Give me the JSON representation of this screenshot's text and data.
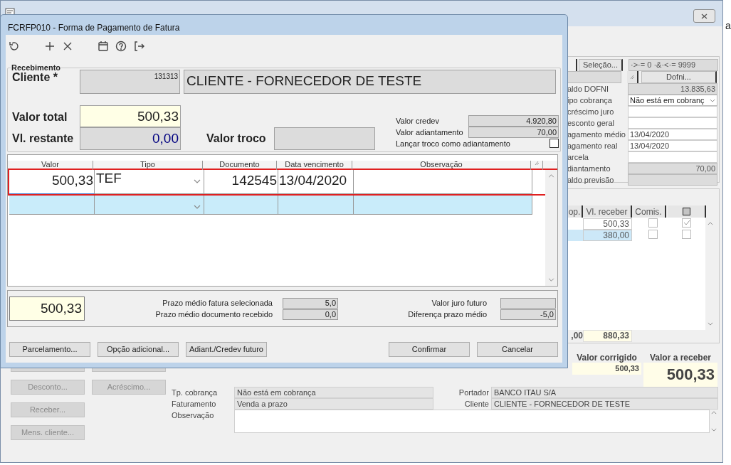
{
  "background_window": {
    "right_panel": {
      "selection_button": "Seleção...",
      "filter": "·>·= 0 ·&·<·= 9999",
      "dofni_button": "Dofni...",
      "fields": [
        {
          "label": "aldo DOFNI",
          "value": "13.835,63",
          "kind": "readonly"
        },
        {
          "label": "ipo cobrança",
          "value": "Não está em cobranç",
          "kind": "dropdown"
        },
        {
          "label": "créscimo juro",
          "kind": "input"
        },
        {
          "label": "esconto geral",
          "kind": "input"
        },
        {
          "label": "agamento médio",
          "value": "13/04/2020",
          "kind": "input"
        },
        {
          "label": "agamento real",
          "value": "13/04/2020",
          "kind": "input"
        },
        {
          "label": "arcela",
          "kind": "input"
        },
        {
          "label": "diantamento",
          "value": "70,00",
          "kind": "readonly"
        },
        {
          "label": "aldo previsão",
          "kind": "readonly"
        }
      ]
    },
    "installments": {
      "columns": [
        "op.",
        "Vl. receber",
        "Comis."
      ],
      "rows": [
        {
          "value": "500,33",
          "comis": false,
          "checked": true,
          "selected": false
        },
        {
          "value": "380,00",
          "comis": false,
          "checked": false,
          "selected": true
        }
      ],
      "totals": [
        ",00",
        "880,33"
      ]
    },
    "summary": {
      "columns": [
        "Valor corrigido",
        "Valor a receber"
      ],
      "values": [
        "500,33",
        "500,33"
      ]
    },
    "buttons_column_1": [
      {
        "label": "Desconto...",
        "disabled": true
      },
      {
        "label": "Receber...",
        "disabled": true
      },
      {
        "label": "Mens. cliente...",
        "disabled": true
      }
    ],
    "buttons_column_2": [
      {
        "label": "Acréscimo...",
        "disabled": true
      }
    ],
    "details_left": [
      {
        "label": "Tp. cobrança",
        "value": "Não está em cobrança"
      },
      {
        "label": "Faturamento",
        "value": "Venda a prazo"
      }
    ],
    "details_right": [
      {
        "label": "Portador",
        "value": "BANCO ITAU S/A"
      },
      {
        "label": "Cliente",
        "value": "CLIENTE - FORNECEDOR DE TESTE"
      }
    ],
    "observation_label": "Observação"
  },
  "desktop_text": "a",
  "dialog": {
    "title": "FCRFP010 - Forma de Pagamento de Fatura",
    "group_title": "Recebimento",
    "client": {
      "label": "Cliente *",
      "code": "131313",
      "name": "CLIENTE - FORNECEDOR DE TESTE"
    },
    "total": {
      "label": "Valor total",
      "value": "500,33"
    },
    "remaining": {
      "label": "Vl. restante",
      "value": "0,00"
    },
    "change": {
      "label": "Valor troco"
    },
    "credev": {
      "label": "Valor credev",
      "value": "4.920,80"
    },
    "advance": {
      "label": "Valor adiantamento",
      "value": "70,00"
    },
    "change_as_advance": {
      "label": "Lançar troco como adiantamento",
      "checked": false
    },
    "payments": {
      "columns": [
        "Valor",
        "Tipo",
        "Documento",
        "Data vencimento",
        "Observação"
      ],
      "rows": [
        {
          "valor": "500,33",
          "tipo": "TEF",
          "documento": "142545",
          "data": "13/04/2020",
          "selected": false,
          "highlighted": true
        },
        {
          "selected": true,
          "highlighted": false
        }
      ]
    },
    "footer_total": "500,33",
    "terms": [
      {
        "label": "Prazo médio fatura selecionada",
        "value": "5,0"
      },
      {
        "label": "Prazo médio documento recebido",
        "value": "0,0"
      }
    ],
    "future": [
      {
        "label": "Valor juro futuro"
      },
      {
        "label": "Diferença prazo médio",
        "value": "-5,0"
      }
    ],
    "buttons_left": [
      "Parcelamento...",
      "Opção adicional...",
      "Adiant./Credev futuro"
    ],
    "buttons_right": [
      "Confirmar",
      "Cancelar"
    ]
  }
}
